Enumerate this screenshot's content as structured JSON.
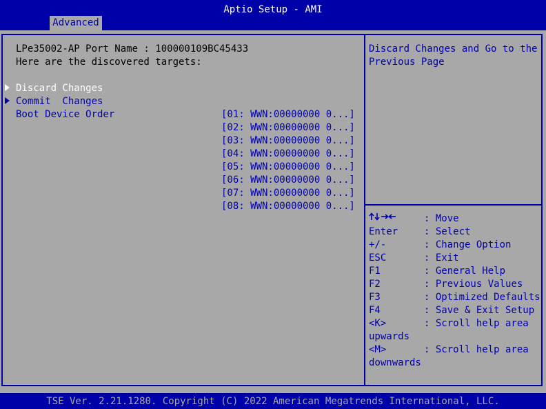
{
  "header": {
    "title": "Aptio Setup - AMI",
    "tab": "Advanced"
  },
  "content": {
    "port_line": "LPe35002-AP Port Name : 100000109BC45433",
    "targets_line": "Here are the discovered targets:",
    "discard_label": "Discard Changes",
    "commit_label": "Commit  Changes",
    "boot_label": "Boot Device Order",
    "boot_devices": [
      "[01: WWN:00000000 0...]",
      "[02: WWN:00000000 0...]",
      "[03: WWN:00000000 0...]",
      "[04: WWN:00000000 0...]",
      "[05: WWN:00000000 0...]",
      "[06: WWN:00000000 0...]",
      "[07: WWN:00000000 0...]",
      "[08: WWN:00000000 0...]"
    ]
  },
  "help": {
    "line1": "Discard Changes and Go to the",
    "line2": "Previous Page"
  },
  "keys": [
    {
      "key": "",
      "desc": ": Move"
    },
    {
      "key": "Enter",
      "desc": ": Select"
    },
    {
      "key": "+/-",
      "desc": ": Change Option"
    },
    {
      "key": "ESC",
      "desc": ": Exit"
    },
    {
      "key": "F1",
      "desc": ": General Help"
    },
    {
      "key": "F2",
      "desc": ": Previous Values"
    },
    {
      "key": "F3",
      "desc": ": Optimized Defaults"
    },
    {
      "key": "F4",
      "desc": ": Save & Exit Setup"
    },
    {
      "key": "<K>",
      "desc": ": Scroll help area"
    },
    {
      "key": "upwards",
      "desc": ""
    },
    {
      "key": "<M>",
      "desc": ": Scroll help area"
    },
    {
      "key": "downwards",
      "desc": ""
    }
  ],
  "footer": {
    "text": "TSE Ver. 2.21.1280. Copyright (C) 2022 American Megatrends International, LLC."
  }
}
